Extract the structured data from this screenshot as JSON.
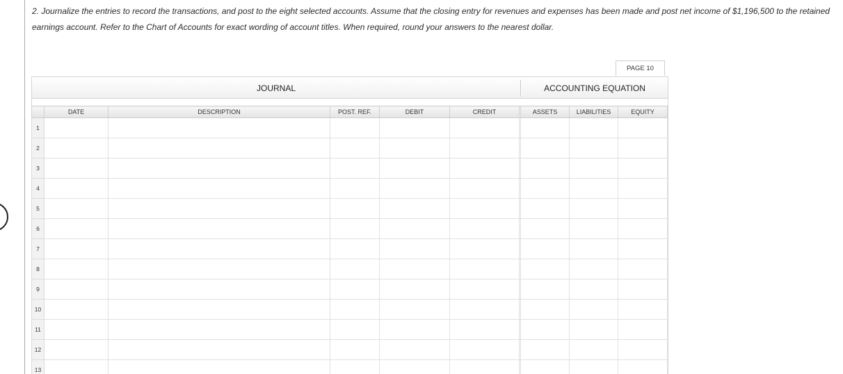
{
  "instructions": "2. Journalize the entries to record the transactions, and post to the eight selected accounts. Assume that the closing entry for revenues and expenses has been made and post net income of $1,196,500 to the retained earnings account. Refer to the Chart of Accounts for exact wording of account titles. When required, round your answers to the nearest dollar.",
  "page_tab": "PAGE 10",
  "journal_title": "JOURNAL",
  "equation_title": "ACCOUNTING EQUATION",
  "columns": {
    "date": "DATE",
    "description": "DESCRIPTION",
    "post_ref": "POST. REF.",
    "debit": "DEBIT",
    "credit": "CREDIT",
    "assets": "ASSETS",
    "liabilities": "LIABILITIES",
    "equity": "EQUITY"
  },
  "rows": [
    "1",
    "2",
    "3",
    "4",
    "5",
    "6",
    "7",
    "8",
    "9",
    "10",
    "11",
    "12",
    "13"
  ]
}
